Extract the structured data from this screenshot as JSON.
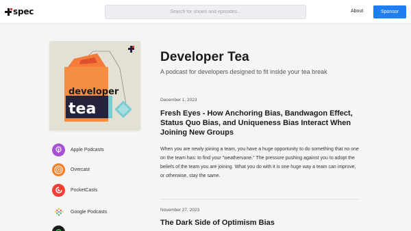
{
  "brand": {
    "name": "spec"
  },
  "search": {
    "placeholder": "Search for shows and episodes..."
  },
  "nav": {
    "about": "About",
    "sponsor": "Sponsor"
  },
  "podcast": {
    "title": "Developer Tea",
    "subtitle": "A podcast for developers designed to fit inside your tea break",
    "cover_text_top": "developer",
    "cover_text_bottom": "tea"
  },
  "platforms": [
    {
      "label": "Apple Podcasts",
      "icon": "apple-podcasts-icon",
      "color": "#a650d6"
    },
    {
      "label": "Overcast",
      "icon": "overcast-icon",
      "color": "#f57f22"
    },
    {
      "label": "PocketCasts",
      "icon": "pocketcasts-icon",
      "color": "#f43e37"
    },
    {
      "label": "Google Podcasts",
      "icon": "google-podcasts-icon",
      "color": "#4285f4"
    }
  ],
  "episodes": [
    {
      "date": "December 1, 2023",
      "title": "Fresh Eyes - How Anchoring Bias, Bandwagon Effect, Status Quo Bias, and Uniqueness Bias Interact When Joining New Groups",
      "description": "When you are newly joining a team, you have a huge opportunity to do something that no one on the team has: to find your \"weathervane.\" The pressure pushing against you to adopt the beliefs of the team you are joining. What you do with it is one huge way a team can improve, or otherwise, stay the same."
    },
    {
      "date": "November 27, 2023",
      "title": "The Dark Side of Optimism Bias"
    }
  ],
  "colors": {
    "accent": "#1f7ef2",
    "cover_bg": "#e3e0d4",
    "tea_orange": "#f68d45",
    "tea_navy": "#25223c",
    "tea_teal": "#76ccd0"
  }
}
